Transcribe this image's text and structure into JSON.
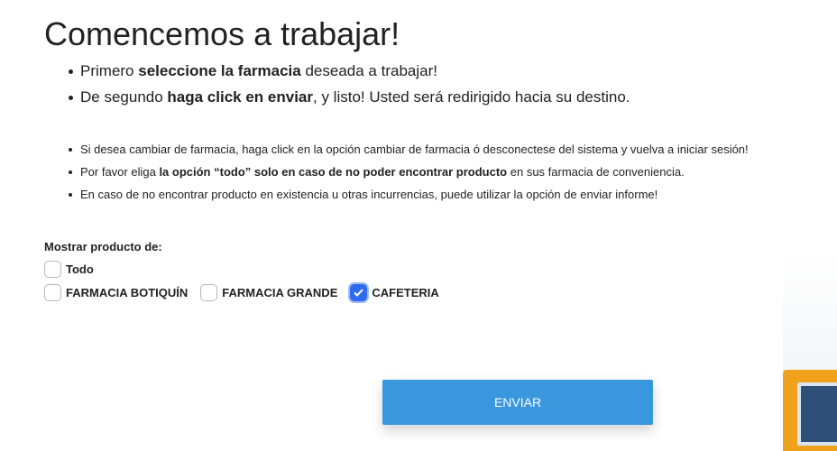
{
  "page": {
    "title": "Comencemos a trabajar!"
  },
  "instructions": {
    "primary": [
      {
        "pre": "Primero ",
        "bold": "seleccione la farmacia",
        "post": " deseada a trabajar!"
      },
      {
        "pre": "De segundo ",
        "bold": "haga click en enviar",
        "post": ", y listo! Usted será redirigido hacia su destino."
      }
    ],
    "secondary": [
      {
        "pre": "Si desea cambiar de farmacia, haga click en la opción cambiar de farmacia ó desconectese del sistema y vuelva a iniciar sesión!",
        "bold": "",
        "post": ""
      },
      {
        "pre": "Por favor eliga ",
        "bold": "la opción “todo” solo en caso de no poder encontrar producto",
        "post": " en sus farmacia de conveniencia."
      },
      {
        "pre": "En caso de no encontrar producto en existencia u otras incurrencias, puede utilizar la opción de enviar informe!",
        "bold": "",
        "post": ""
      }
    ]
  },
  "filter": {
    "label": "Mostrar producto de:",
    "options": [
      {
        "label": "Todo",
        "checked": false
      },
      {
        "label": "FARMACIA BOTIQUÍN",
        "checked": false
      },
      {
        "label": "FARMACIA GRANDE",
        "checked": false
      },
      {
        "label": "CAFETERIA",
        "checked": true
      }
    ]
  },
  "actions": {
    "submit_label": "ENVIAR"
  },
  "colors": {
    "accent": "#3a97dd",
    "checkbox_checked": "#2d6cf0",
    "text": "#222222"
  }
}
